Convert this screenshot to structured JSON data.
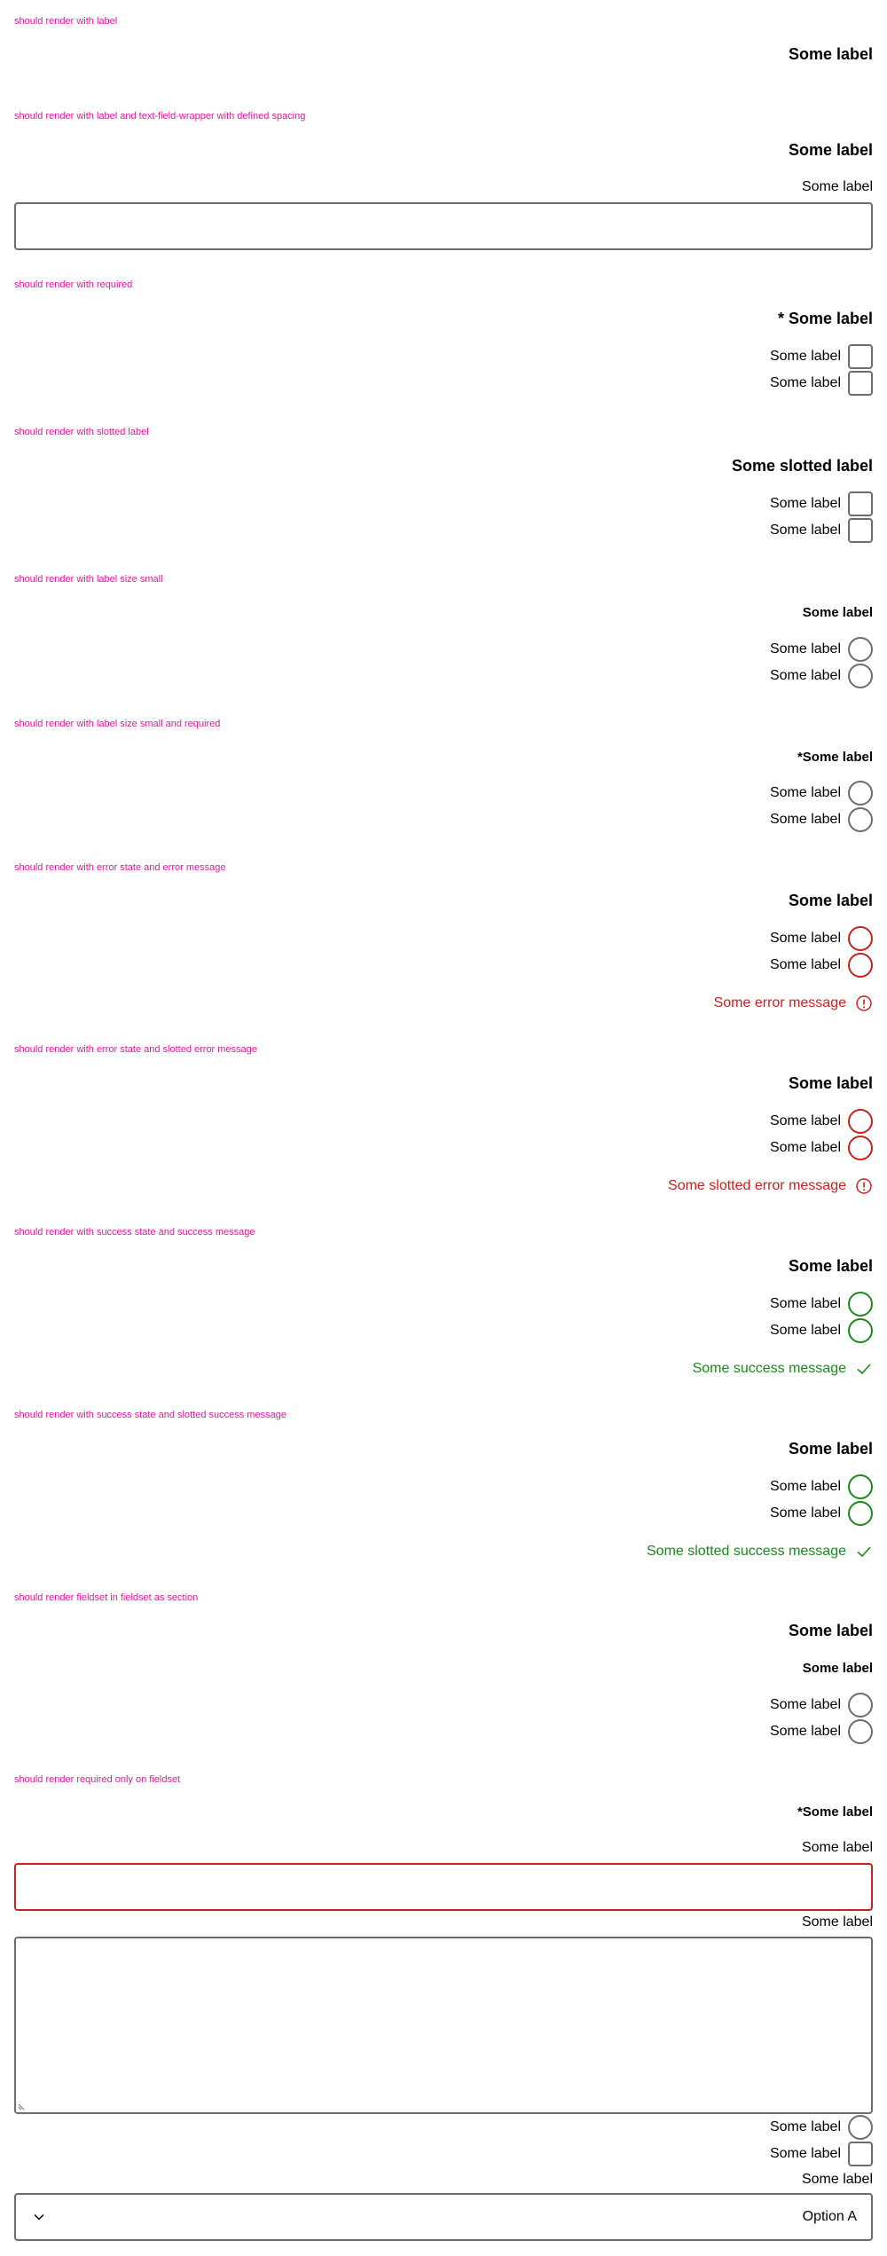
{
  "cases": {
    "c1": "should render with label",
    "c2": "should render with label and text-field-wrapper with defined spacing",
    "c3": "should render with required",
    "c4": "should render with slotted label",
    "c5": "should render with label size small",
    "c6": "should render with label size small and required",
    "c7": "should render with error state and error message",
    "c8": "should render with error state and slotted error message",
    "c9": "should render with success state and success message",
    "c10": "should render with success state and slotted success message",
    "c11": "should render fieldset in fieldset as section",
    "c12": "should render required only on fieldset"
  },
  "legend": "Some label",
  "legend_required": "* Some label",
  "legend_small_required": "*Some label",
  "legend_slotted": "Some slotted label",
  "option_label": "Some label",
  "field_label": "Some label",
  "messages": {
    "error": "Some error message",
    "error_slotted": "Some slotted error message",
    "success": "Some success message",
    "success_slotted": "Some slotted success message"
  },
  "select": {
    "value": "Option A"
  },
  "colors": {
    "caption": "#e0189c",
    "error": "#c9211e",
    "success": "#1b8a1b",
    "border": "#6b6d70"
  },
  "icons": {
    "error": "exclamation-circle-icon",
    "success": "checkmark-icon",
    "select": "chevron-down-icon"
  }
}
